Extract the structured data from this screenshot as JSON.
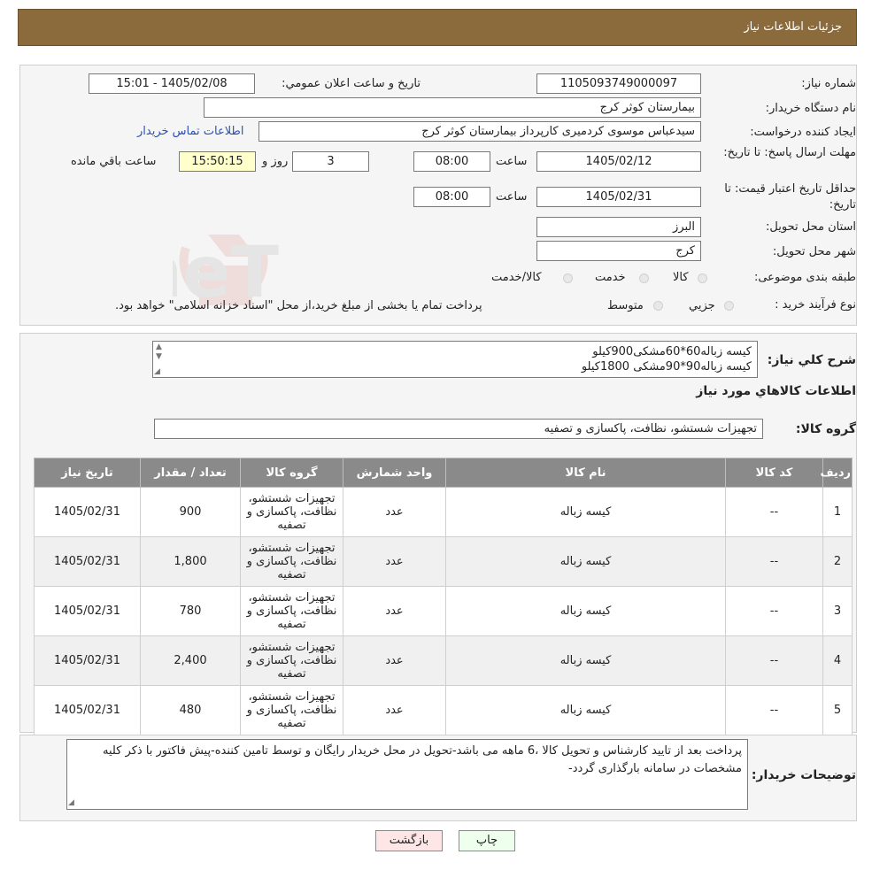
{
  "header": {
    "title": "جزئیات اطلاعات نیاز"
  },
  "form": {
    "need_number_label": "شماره نیاز:",
    "need_number": "1105093749000097",
    "announce_label": "تاريخ و ساعت اعلان عمومي:",
    "announce_value": "1405/02/08 - 15:01",
    "buyer_label": "نام دستگاه خريدار:",
    "buyer_value": "بیمارستان کوثر کرج",
    "requester_label": "ايجاد کننده درخواست:",
    "requester_value": "سیدعباس موسوی کردمیری کارپرداز بیمارستان کوثر کرج",
    "contact_link": "اطلاعات تماس خريدار",
    "deadline_label": "مهلت ارسال پاسخ: تا تاريخ:",
    "deadline_date": "1405/02/12",
    "time_label": "ساعت",
    "deadline_time": "08:00",
    "days_value": "3",
    "days_label": "روز و",
    "remaining_time": "15:50:15",
    "remaining_label": "ساعت باقي مانده",
    "validity_label": "حداقل تاريخ اعتبار قيمت: تا تاريخ:",
    "validity_date": "1405/02/31",
    "validity_time": "08:00",
    "province_label": "استان محل تحويل:",
    "province_value": "البرز",
    "city_label": "شهر محل تحويل:",
    "city_value": "کرج",
    "category_label": "طبقه بندی موضوعی:",
    "category_options": [
      "کالا",
      "خدمت",
      "کالا/خدمت"
    ],
    "process_label": "نوع فرآيند خريد :",
    "process_options": [
      "جزيي",
      "متوسط"
    ],
    "process_note": "پرداخت تمام یا بخشی از مبلغ خرید،از محل \"اسناد خزانه اسلامی\" خواهد بود."
  },
  "summary": {
    "label": "شرح كلي نياز:",
    "line1": "کیسه زباله60*60مشکی900کیلو",
    "line2": "کیسه زباله90*90مشکی 1800کیلو"
  },
  "goods": {
    "title": "اطلاعات كالاهاي مورد نياز",
    "group_label": "گروه كالا:",
    "group_value": "تجهیزات شستشو، نظافت، پاکسازی و تصفیه"
  },
  "table": {
    "headers": [
      "رديف",
      "كد كالا",
      "نام كالا",
      "واحد شمارش",
      "گروه كالا",
      "تعداد / مقدار",
      "تاريخ نياز"
    ],
    "rows": [
      {
        "row": "1",
        "code": "--",
        "name": "کیسه زباله",
        "unit": "عدد",
        "group": "تجهیزات شستشو، نظافت، پاکسازی و تصفیه",
        "qty": "900",
        "date": "1405/02/31"
      },
      {
        "row": "2",
        "code": "--",
        "name": "کیسه زباله",
        "unit": "عدد",
        "group": "تجهیزات شستشو، نظافت، پاکسازی و تصفیه",
        "qty": "1,800",
        "date": "1405/02/31"
      },
      {
        "row": "3",
        "code": "--",
        "name": "کیسه زباله",
        "unit": "عدد",
        "group": "تجهیزات شستشو، نظافت، پاکسازی و تصفیه",
        "qty": "780",
        "date": "1405/02/31"
      },
      {
        "row": "4",
        "code": "--",
        "name": "کیسه زباله",
        "unit": "عدد",
        "group": "تجهیزات شستشو، نظافت، پاکسازی و تصفیه",
        "qty": "2,400",
        "date": "1405/02/31"
      },
      {
        "row": "5",
        "code": "--",
        "name": "کیسه زباله",
        "unit": "عدد",
        "group": "تجهیزات شستشو، نظافت، پاکسازی و تصفیه",
        "qty": "480",
        "date": "1405/02/31"
      }
    ]
  },
  "notes": {
    "label": "توضيحات خريدار:",
    "text": "پرداخت بعد از تایید کارشناس و تحویل کالا ،6 ماهه می باشد-تحویل در محل خریدار رایگان و توسط تامین کننده-پیش فاکتور با ذکر کلیه مشخصات در سامانه بارگذاری گردد-"
  },
  "buttons": {
    "print": "چاپ",
    "back": "بازگشت"
  },
  "watermark": {
    "text": "AriaTender.neT"
  },
  "colors": {
    "header": "#8b6a3c",
    "link": "#2851b5",
    "highlight": "#ffffcc"
  }
}
